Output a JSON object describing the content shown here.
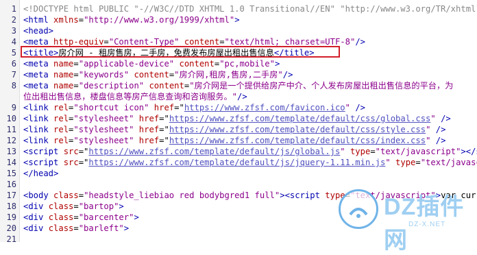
{
  "lines": [
    {
      "n": "1",
      "segs": [
        {
          "c": "gray",
          "t": "<!DOCTYPE html PUBLIC \"-//W3C//DTD XHTML 1.0 Transitional//EN\" \"http://www.w3.org/TR/xhtml1/DT"
        }
      ]
    },
    {
      "n": "2",
      "segs": [
        {
          "c": "t",
          "t": "<html "
        },
        {
          "c": "a",
          "t": "xmlns"
        },
        {
          "c": "x",
          "t": "="
        },
        {
          "c": "s",
          "t": "\"http://www.w3.org/1999/xhtml\""
        },
        {
          "c": "t",
          "t": ">"
        }
      ]
    },
    {
      "n": "3",
      "segs": [
        {
          "c": "t",
          "t": "<head>"
        }
      ]
    },
    {
      "n": "4",
      "segs": [
        {
          "c": "t",
          "t": "<meta "
        },
        {
          "c": "a",
          "t": "http-equiv"
        },
        {
          "c": "x",
          "t": "="
        },
        {
          "c": "s",
          "t": "\"Content-Type\""
        },
        {
          "c": "x",
          "t": " "
        },
        {
          "c": "a",
          "t": "content"
        },
        {
          "c": "x",
          "t": "="
        },
        {
          "c": "s",
          "t": "\"text/html; charset=UTF-8\""
        },
        {
          "c": "t",
          "t": "/>"
        }
      ]
    },
    {
      "n": "5",
      "segs": [
        {
          "c": "t",
          "t": "<title>"
        },
        {
          "c": "x",
          "t": "房介网 - 租房售房，二手房，免费发布房屋出租出售信息"
        },
        {
          "c": "t",
          "t": "</title>"
        }
      ]
    },
    {
      "n": "6",
      "segs": [
        {
          "c": "t",
          "t": "<meta "
        },
        {
          "c": "a",
          "t": "name"
        },
        {
          "c": "x",
          "t": "="
        },
        {
          "c": "s",
          "t": "\"applicable-device\""
        },
        {
          "c": "x",
          "t": " "
        },
        {
          "c": "a",
          "t": "content"
        },
        {
          "c": "x",
          "t": "="
        },
        {
          "c": "s",
          "t": "\"pc,mobile\""
        },
        {
          "c": "t",
          "t": ">"
        }
      ]
    },
    {
      "n": "7",
      "segs": [
        {
          "c": "t",
          "t": "<meta "
        },
        {
          "c": "a",
          "t": "name"
        },
        {
          "c": "x",
          "t": "="
        },
        {
          "c": "s",
          "t": "\"keywords\""
        },
        {
          "c": "x",
          "t": " "
        },
        {
          "c": "a",
          "t": "content"
        },
        {
          "c": "x",
          "t": "="
        },
        {
          "c": "s",
          "t": "\"房介网,租房,售房,二手房\""
        },
        {
          "c": "t",
          "t": "/>"
        }
      ]
    },
    {
      "n": "8",
      "segs": [
        {
          "c": "t",
          "t": "<meta "
        },
        {
          "c": "a",
          "t": "name"
        },
        {
          "c": "x",
          "t": "="
        },
        {
          "c": "s",
          "t": "\"description\""
        },
        {
          "c": "x",
          "t": " "
        },
        {
          "c": "a",
          "t": "content"
        },
        {
          "c": "x",
          "t": "="
        },
        {
          "c": "s",
          "t": "\"房介网是一个提供给房产中介、个人发布房屋出租出售信息的平台，为"
        }
      ]
    },
    {
      "n": "",
      "segs": [
        {
          "c": "s",
          "t": "位出租出售信息，楼盘信息等房产信息查询和咨询服务。\""
        },
        {
          "c": "t",
          "t": "/>"
        }
      ]
    },
    {
      "n": "9",
      "segs": [
        {
          "c": "t",
          "t": "<link "
        },
        {
          "c": "a",
          "t": "rel"
        },
        {
          "c": "x",
          "t": "="
        },
        {
          "c": "s",
          "t": "\"shortcut icon\""
        },
        {
          "c": "x",
          "t": " "
        },
        {
          "c": "a",
          "t": "href"
        },
        {
          "c": "x",
          "t": "=\""
        },
        {
          "c": "u",
          "t": "https://www.zfsf.com/favicon.ico"
        },
        {
          "c": "s",
          "t": "\""
        },
        {
          "c": "t",
          "t": " />"
        }
      ]
    },
    {
      "n": "10",
      "segs": [
        {
          "c": "t",
          "t": "<link "
        },
        {
          "c": "a",
          "t": "rel"
        },
        {
          "c": "x",
          "t": "="
        },
        {
          "c": "s",
          "t": "\"stylesheet\""
        },
        {
          "c": "x",
          "t": " "
        },
        {
          "c": "a",
          "t": "href"
        },
        {
          "c": "x",
          "t": "=\""
        },
        {
          "c": "u",
          "t": "https://www.zfsf.com/template/default/css/global.css"
        },
        {
          "c": "s",
          "t": "\""
        },
        {
          "c": "t",
          "t": " />"
        }
      ]
    },
    {
      "n": "11",
      "segs": [
        {
          "c": "t",
          "t": "<link "
        },
        {
          "c": "a",
          "t": "rel"
        },
        {
          "c": "x",
          "t": "="
        },
        {
          "c": "s",
          "t": "\"stylesheet\""
        },
        {
          "c": "x",
          "t": " "
        },
        {
          "c": "a",
          "t": "href"
        },
        {
          "c": "x",
          "t": "=\""
        },
        {
          "c": "u",
          "t": "https://www.zfsf.com/template/default/css/style.css"
        },
        {
          "c": "s",
          "t": "\""
        },
        {
          "c": "t",
          "t": " />"
        }
      ]
    },
    {
      "n": "12",
      "segs": [
        {
          "c": "t",
          "t": "<link "
        },
        {
          "c": "a",
          "t": "rel"
        },
        {
          "c": "x",
          "t": "="
        },
        {
          "c": "s",
          "t": "\"stylesheet\""
        },
        {
          "c": "x",
          "t": " "
        },
        {
          "c": "a",
          "t": "href"
        },
        {
          "c": "x",
          "t": "=\""
        },
        {
          "c": "u",
          "t": "https://www.zfsf.com/template/default/css/index.css"
        },
        {
          "c": "s",
          "t": "\""
        },
        {
          "c": "t",
          "t": " />"
        }
      ]
    },
    {
      "n": "13",
      "segs": [
        {
          "c": "t",
          "t": "<script "
        },
        {
          "c": "a",
          "t": "src"
        },
        {
          "c": "x",
          "t": "=\""
        },
        {
          "c": "u",
          "t": "https://www.zfsf.com/template/default/js/global.js"
        },
        {
          "c": "s",
          "t": "\""
        },
        {
          "c": "x",
          "t": " "
        },
        {
          "c": "a",
          "t": "type"
        },
        {
          "c": "x",
          "t": "="
        },
        {
          "c": "s",
          "t": "\"text/javascript\""
        },
        {
          "c": "t",
          "t": "></scrip"
        }
      ]
    },
    {
      "n": "14",
      "segs": [
        {
          "c": "t",
          "t": "<script "
        },
        {
          "c": "a",
          "t": "src"
        },
        {
          "c": "x",
          "t": "=\""
        },
        {
          "c": "u",
          "t": "https://www.zfsf.com/template/default/js/jquery-1.11.min.js"
        },
        {
          "c": "s",
          "t": "\""
        },
        {
          "c": "x",
          "t": " "
        },
        {
          "c": "a",
          "t": "type"
        },
        {
          "c": "x",
          "t": "="
        },
        {
          "c": "s",
          "t": "\"text/javascri"
        }
      ]
    },
    {
      "n": "15",
      "segs": [
        {
          "c": "t",
          "t": "</head>"
        }
      ]
    },
    {
      "n": "16",
      "segs": []
    },
    {
      "n": "17",
      "segs": [
        {
          "c": "t",
          "t": "<body "
        },
        {
          "c": "a",
          "t": "class"
        },
        {
          "c": "x",
          "t": "="
        },
        {
          "c": "s",
          "t": "\"headstyle_liebiao red bodybgred1 full\""
        },
        {
          "c": "t",
          "t": "><script "
        },
        {
          "c": "a",
          "t": "type"
        },
        {
          "c": "x",
          "t": "="
        },
        {
          "c": "s",
          "t": "\"text/javascript\""
        },
        {
          "c": "t",
          "t": ">"
        },
        {
          "c": "x",
          "t": "var current_"
        }
      ]
    },
    {
      "n": "18",
      "segs": [
        {
          "c": "t",
          "t": "<div "
        },
        {
          "c": "a",
          "t": "class"
        },
        {
          "c": "x",
          "t": "="
        },
        {
          "c": "s",
          "t": "\"bartop\""
        },
        {
          "c": "t",
          "t": ">"
        }
      ]
    },
    {
      "n": "19",
      "segs": [
        {
          "c": "t",
          "t": "<div "
        },
        {
          "c": "a",
          "t": "class"
        },
        {
          "c": "x",
          "t": "="
        },
        {
          "c": "s",
          "t": "\"barcenter\""
        },
        {
          "c": "t",
          "t": ">"
        }
      ]
    },
    {
      "n": "20",
      "segs": [
        {
          "c": "t",
          "t": "<div "
        },
        {
          "c": "a",
          "t": "class"
        },
        {
          "c": "x",
          "t": "="
        },
        {
          "c": "s",
          "t": "\"barleft\""
        },
        {
          "c": "t",
          "t": ">"
        }
      ]
    },
    {
      "n": "21",
      "segs": []
    },
    {
      "n": "22",
      "segs": [
        {
          "c": "t",
          "t": "<ul "
        },
        {
          "c": "a",
          "t": "class"
        },
        {
          "c": "x",
          "t": "="
        },
        {
          "c": "s",
          "t": "\"barcity\""
        },
        {
          "c": "t",
          "t": "><span>"
        },
        {
          "c": "x",
          "t": "欢迎访问房介网"
        },
        {
          "c": "t",
          "t": "</span></ul>"
        }
      ]
    }
  ],
  "watermark": {
    "brand": "DZ插件网",
    "url": "DZ-X.NET",
    "accent": "#6fb3e8"
  }
}
